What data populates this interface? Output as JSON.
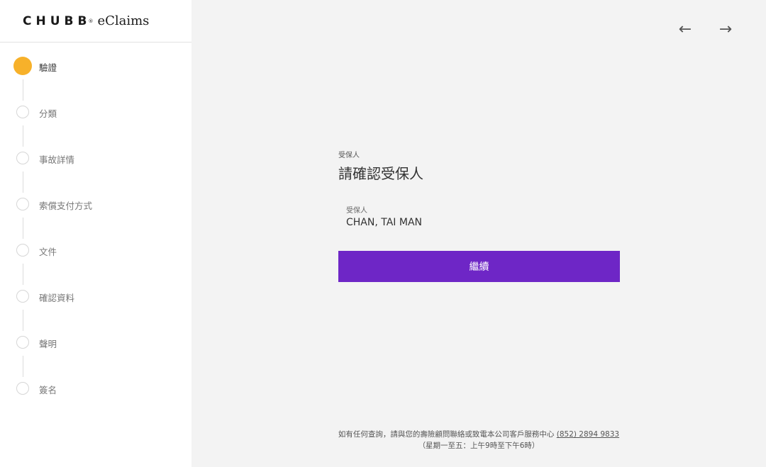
{
  "brand": {
    "logo": "CHUBB",
    "registered": "®",
    "product": "eClaims"
  },
  "nav": {
    "back_icon": "←",
    "forward_icon": "→"
  },
  "steps": [
    {
      "label": "驗證",
      "active": true
    },
    {
      "label": "分類",
      "active": false
    },
    {
      "label": "事故詳情",
      "active": false
    },
    {
      "label": "索償支付方式",
      "active": false
    },
    {
      "label": "文件",
      "active": false
    },
    {
      "label": "確認資料",
      "active": false
    },
    {
      "label": "聲明",
      "active": false
    },
    {
      "label": "簽名",
      "active": false
    }
  ],
  "form": {
    "kicker": "受保人",
    "title": "請確認受保人",
    "field_label": "受保人",
    "field_value": "CHAN, TAI MAN",
    "continue_label": "繼續"
  },
  "footer": {
    "line1_text": "如有任何查詢，請與您的壽險顧問聯絡或致電本公司客戶服務中心 ",
    "phone": "(852) 2894 9833",
    "line2": "（星期一至五：上午9時至下午6時）"
  },
  "colors": {
    "accent": "#6e26c6",
    "active_step": "#f7b12a"
  }
}
